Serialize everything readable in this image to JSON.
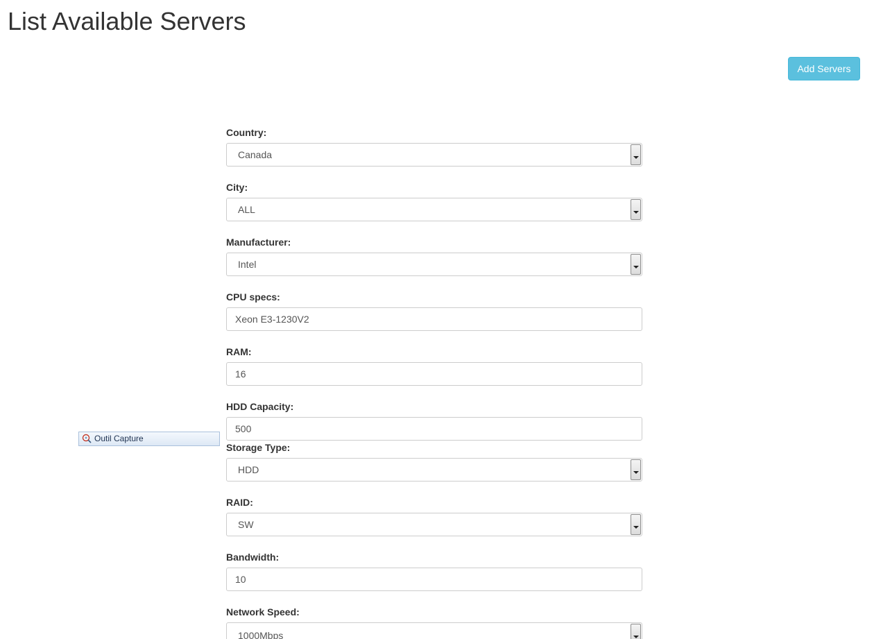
{
  "page": {
    "title": "List Available Servers",
    "add_button_label": "Add Servers"
  },
  "form": {
    "country": {
      "label": "Country:",
      "value": "Canada"
    },
    "city": {
      "label": "City:",
      "value": "ALL"
    },
    "manufacturer": {
      "label": "Manufacturer:",
      "value": "Intel"
    },
    "cpu_specs": {
      "label": "CPU specs:",
      "value": "Xeon E3-1230V2"
    },
    "ram": {
      "label": "RAM:",
      "value": "16"
    },
    "hdd_capacity": {
      "label": "HDD Capacity:",
      "value": "500"
    },
    "storage_type": {
      "label": "Storage Type:",
      "value": "HDD"
    },
    "raid": {
      "label": "RAID:",
      "value": "SW"
    },
    "bandwidth": {
      "label": "Bandwidth:",
      "value": "10"
    },
    "network_speed": {
      "label": "Network Speed:",
      "value": "1000Mbps"
    }
  },
  "capture_tool": {
    "label": "Outil Capture",
    "icon": "capture-tool-icon"
  },
  "colors": {
    "button_accent": "#5bc0de",
    "text": "#333333",
    "border": "#cccccc"
  }
}
